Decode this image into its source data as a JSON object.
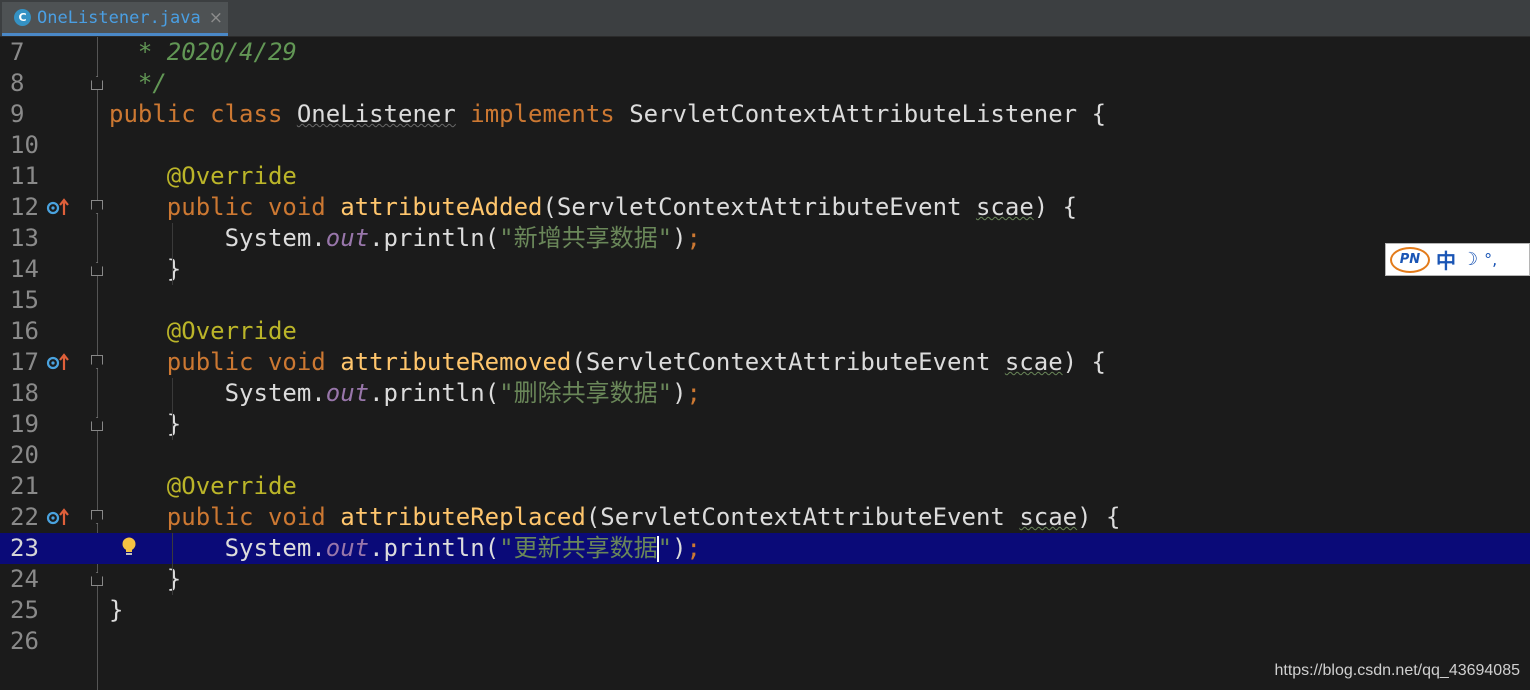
{
  "tab": {
    "icon_letter": "C",
    "filename": "OneListener.java",
    "close": "×"
  },
  "lines": [
    {
      "num": "7",
      "segments": [
        [
          "cmt",
          "  * 2020/4/29"
        ]
      ]
    },
    {
      "num": "8",
      "segments": [
        [
          "cmt",
          "  */"
        ]
      ]
    },
    {
      "num": "9",
      "segments": [
        [
          "kw",
          "public class "
        ],
        [
          "cls cls-under",
          "OneListener"
        ],
        [
          "kw",
          " implements "
        ],
        [
          "cls",
          "ServletContextAttributeListener {"
        ]
      ]
    },
    {
      "num": "10",
      "segments": []
    },
    {
      "num": "11",
      "segments": [
        [
          "ann",
          "    @Override"
        ]
      ]
    },
    {
      "num": "12",
      "segments": [
        [
          "kw",
          "    public void "
        ],
        [
          "method",
          "attributeAdded"
        ],
        [
          "punc",
          "(ServletContextAttributeEvent "
        ],
        [
          "param",
          "scae"
        ],
        [
          "punc",
          ") {"
        ]
      ]
    },
    {
      "num": "13",
      "segments": [
        [
          "punc",
          "        System."
        ],
        [
          "field",
          "out"
        ],
        [
          "punc",
          ".println("
        ],
        [
          "str",
          "\"新增共享数据\""
        ],
        [
          "punc",
          ")"
        ],
        [
          "semi",
          ";"
        ]
      ]
    },
    {
      "num": "14",
      "segments": [
        [
          "punc",
          "    }"
        ]
      ]
    },
    {
      "num": "15",
      "segments": []
    },
    {
      "num": "16",
      "segments": [
        [
          "ann",
          "    @Override"
        ]
      ]
    },
    {
      "num": "17",
      "segments": [
        [
          "kw",
          "    public void "
        ],
        [
          "method",
          "attributeRemoved"
        ],
        [
          "punc",
          "(ServletContextAttributeEvent "
        ],
        [
          "param",
          "scae"
        ],
        [
          "punc",
          ") {"
        ]
      ]
    },
    {
      "num": "18",
      "segments": [
        [
          "punc",
          "        System."
        ],
        [
          "field",
          "out"
        ],
        [
          "punc",
          ".println("
        ],
        [
          "str",
          "\"删除共享数据\""
        ],
        [
          "punc",
          ")"
        ],
        [
          "semi",
          ";"
        ]
      ]
    },
    {
      "num": "19",
      "segments": [
        [
          "punc",
          "    }"
        ]
      ]
    },
    {
      "num": "20",
      "segments": []
    },
    {
      "num": "21",
      "segments": [
        [
          "ann",
          "    @Override"
        ]
      ]
    },
    {
      "num": "22",
      "segments": [
        [
          "kw",
          "    public void "
        ],
        [
          "method",
          "attributeReplaced"
        ],
        [
          "punc",
          "(ServletContextAttributeEvent "
        ],
        [
          "param",
          "scae"
        ],
        [
          "punc",
          ") {"
        ]
      ]
    },
    {
      "num": "23",
      "segments": [
        [
          "punc",
          "        System."
        ],
        [
          "field",
          "out"
        ],
        [
          "punc",
          ".println("
        ],
        [
          "str",
          "\"更新共享数据"
        ],
        [
          "caret",
          ""
        ],
        [
          "str",
          "\""
        ],
        [
          "punc",
          ")"
        ],
        [
          "semi",
          ";"
        ]
      ]
    },
    {
      "num": "24",
      "segments": [
        [
          "punc",
          "    }"
        ]
      ]
    },
    {
      "num": "25",
      "segments": [
        [
          "punc",
          "}"
        ]
      ]
    },
    {
      "num": "26",
      "segments": []
    }
  ],
  "current_line": "23",
  "override_lines": [
    "12",
    "17",
    "22"
  ],
  "fold_top_lines": [
    "12",
    "17",
    "22"
  ],
  "fold_bottom_lines": [
    "8",
    "14",
    "19",
    "24"
  ],
  "bulb_line": "23",
  "ime": {
    "logo": "PN",
    "mode": "中",
    "moon": "☽",
    "punct": "°,"
  },
  "watermark": "https://blog.csdn.net/qq_43694085",
  "colors": {
    "background": "#1b1b1b",
    "keyword": "#cc7832",
    "string": "#6a8759",
    "comment": "#629755",
    "annotation": "#bbb529",
    "method": "#ffc66d",
    "field": "#9876aa",
    "current_line": "#0a0a78"
  }
}
